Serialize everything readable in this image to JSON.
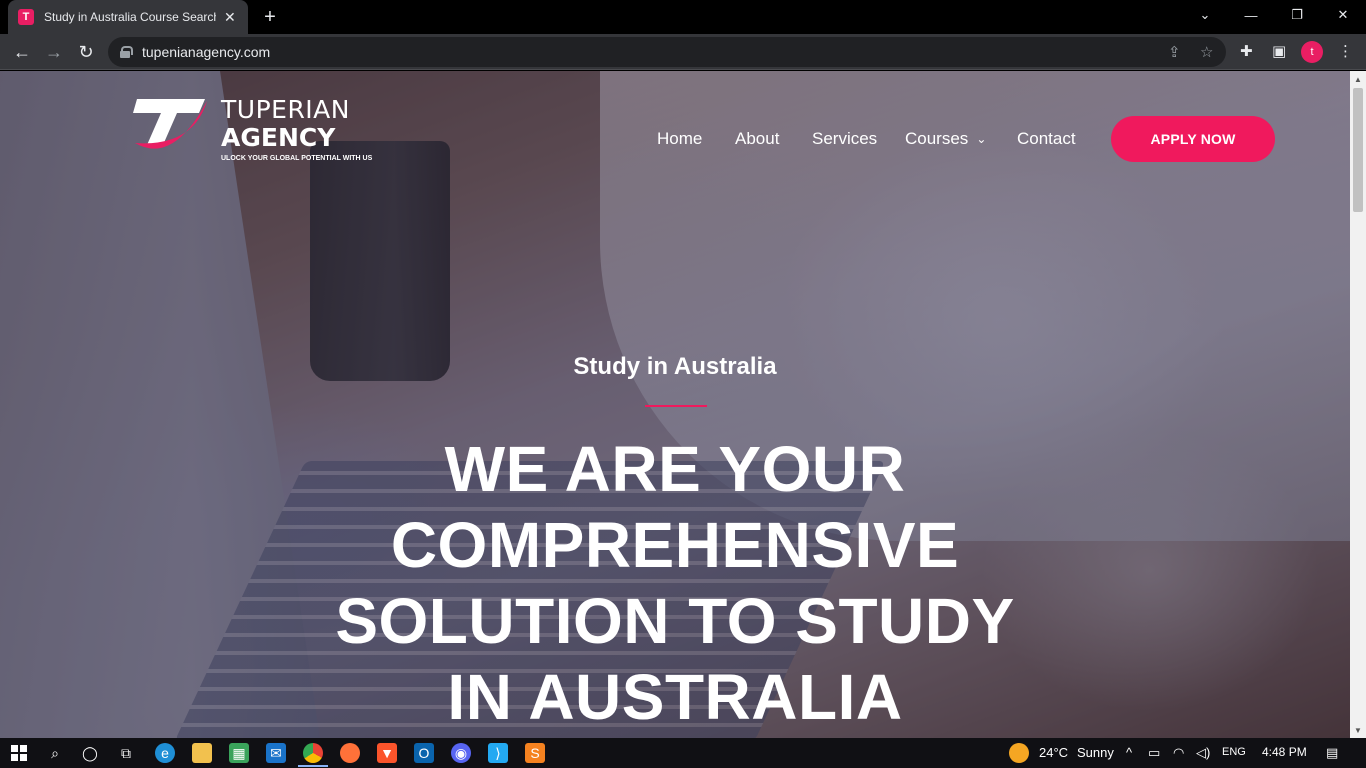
{
  "browser": {
    "tab_title": "Study in Australia Course Search",
    "tab_favicon": "T",
    "url": "tupenianagency.com",
    "profile_initial": "t"
  },
  "site": {
    "logo": {
      "line1": "TUPERIAN",
      "line2": "AGENCY",
      "tagline": "ULOCK YOUR GLOBAL POTENTIAL WITH US"
    },
    "nav": {
      "home": "Home",
      "about": "About",
      "services": "Services",
      "courses": "Courses",
      "contact": "Contact",
      "apply": "APPLY NOW"
    },
    "hero": {
      "subtitle": "Study in Australia",
      "headline_1": "WE ARE YOUR",
      "headline_2": "COMPREHENSIVE",
      "headline_3": "SOLUTION TO STUDY",
      "headline_4": "IN AUSTRALIA"
    },
    "colors": {
      "accent": "#f0195d"
    }
  },
  "taskbar": {
    "weather_temp": "24°C",
    "weather_text": "Sunny",
    "language": "ENG",
    "time": "4:48 PM"
  }
}
